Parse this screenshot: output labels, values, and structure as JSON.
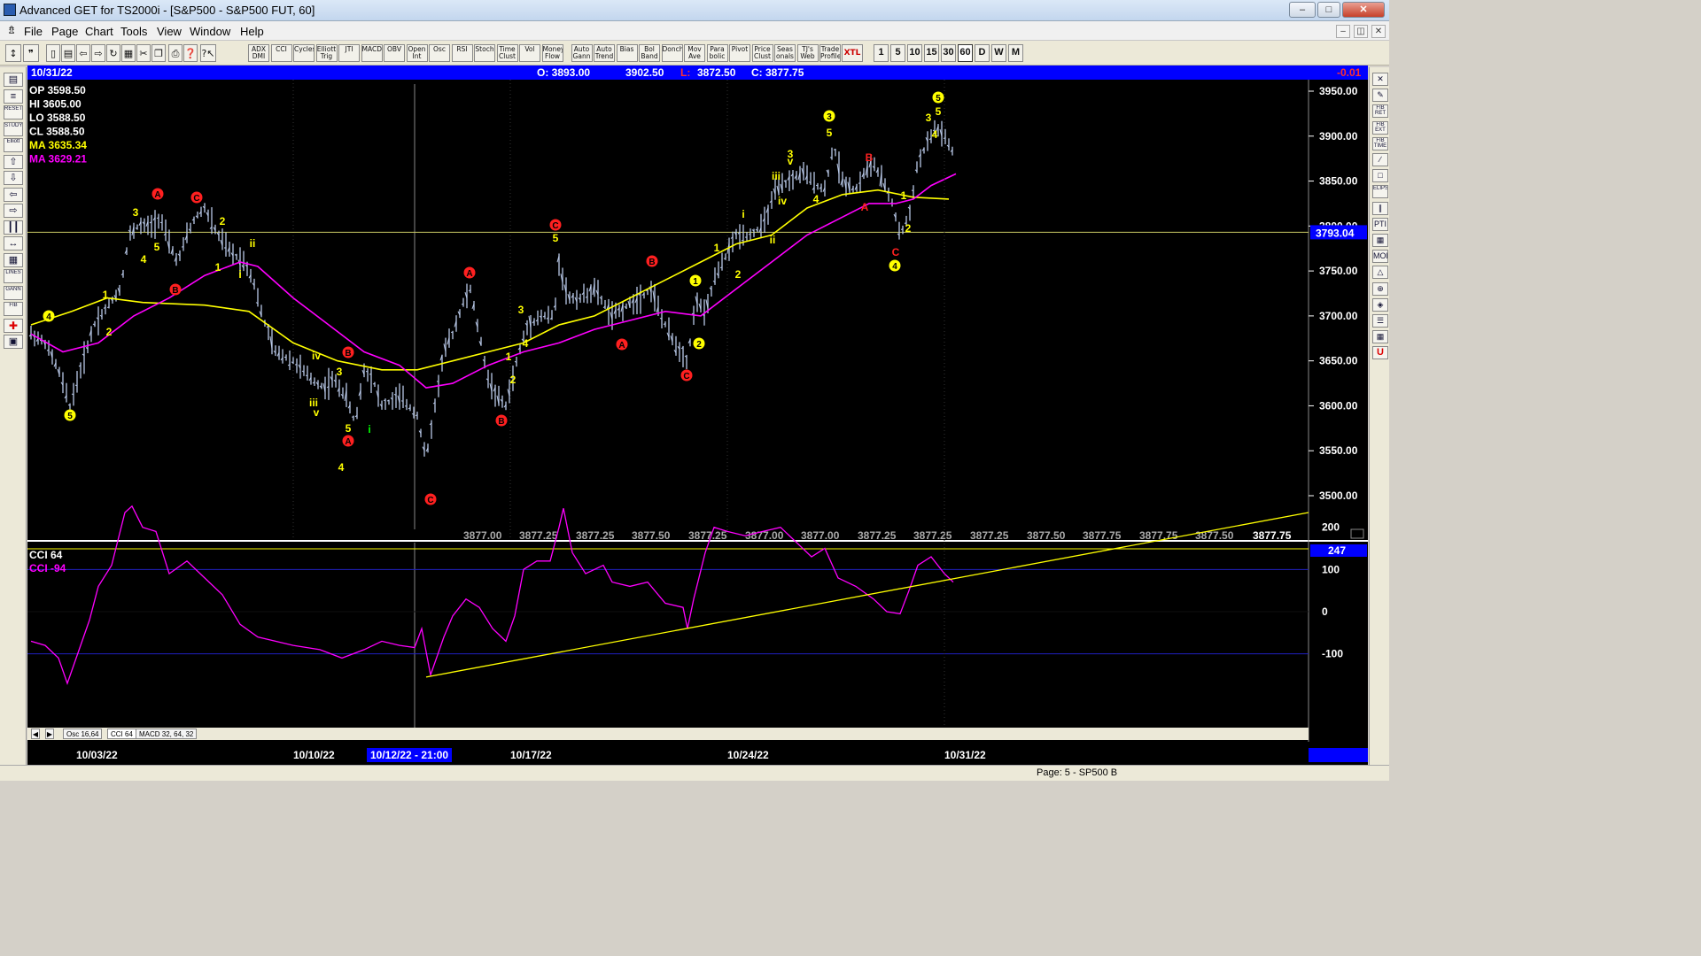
{
  "window": {
    "title": "Advanced GET for TS2000i - [S&P500 - S&P500 FUT, 60]",
    "min": "–",
    "max": "□",
    "close": "✕"
  },
  "menu": [
    "File",
    "Page",
    "Chart",
    "Tools",
    "View",
    "Window",
    "Help"
  ],
  "toolbar_studies": [
    "ADX DMI",
    "CCI",
    "Cycles",
    "Elliott Trig",
    "JTI",
    "MACD",
    "OBV",
    "Open Int",
    "Osc",
    "RSI",
    "Stoch",
    "Time Clust",
    "Vol",
    "Money Flow",
    "Auto Gann",
    "Auto Trend",
    "Bias",
    "Bol Band",
    "Donch",
    "Mov Ave",
    "Para bolic",
    "Pivot",
    "Price Clust",
    "Seas onals",
    "TJ's Web",
    "Trade Profile"
  ],
  "toolbar_xtl": "XTL",
  "intervals": [
    "1",
    "5",
    "10",
    "15",
    "30",
    "60",
    "D",
    "W",
    "M"
  ],
  "infobar": {
    "date": "10/31/22",
    "open": "O: 3893.00",
    "high": "3902.50",
    "low_label": "L:",
    "low": "3872.50",
    "close": "C:  3877.75",
    "change": "-0.01"
  },
  "readout": {
    "op": "OP  3598.50",
    "hi": "HI   3605.00",
    "lo": "LO   3588.50",
    "cl": "CL   3588.50",
    "ma1": "MA  3635.34",
    "ma2": "MA  3629.21"
  },
  "price_axis": [
    "3950.00",
    "3900.00",
    "3850.00",
    "3800.00",
    "3750.00",
    "3700.00",
    "3650.00",
    "3600.00",
    "3550.00",
    "3500.00"
  ],
  "current_price_tag": "3793.04",
  "bottom_prices": [
    "3877.00",
    "3877.25",
    "3877.25",
    "3877.50",
    "3877.25",
    "3877.00",
    "3877.00",
    "3877.25",
    "3877.25",
    "3877.25",
    "3877.50",
    "3877.75",
    "3877.75",
    "3877.50",
    "3877.75"
  ],
  "cci_panel": {
    "label1": "CCI 64",
    "label2": "CCI  -94",
    "axis": [
      "200",
      "100",
      "0",
      "-100"
    ],
    "tag": "247"
  },
  "tabs": [
    "Osc 16,64",
    "CCI 64",
    "MACD 32, 64, 32"
  ],
  "dates": [
    "10/03/22",
    "10/10/22",
    "10/17/22",
    "10/24/22",
    "10/31/22"
  ],
  "cursor_date": "10/12/22 - 21:00",
  "status": "Page: 5 - SP500 B",
  "wave_labels": [
    {
      "t": "5",
      "c": "#ffff00",
      "circle": true
    },
    {
      "t": "4",
      "c": "#ffff00",
      "circle": true
    },
    {
      "t": "1",
      "c": "#ffff00"
    },
    {
      "t": "2",
      "c": "#ffff00"
    },
    {
      "t": "3",
      "c": "#ffff00"
    },
    {
      "t": "4",
      "c": "#ffff00"
    },
    {
      "t": "5",
      "c": "#ffff00"
    },
    {
      "t": "A",
      "c": "#ff2020",
      "circle": true
    },
    {
      "t": "B",
      "c": "#ff2020",
      "circle": true
    },
    {
      "t": "C",
      "c": "#ff2020",
      "circle": true
    },
    {
      "t": "2",
      "c": "#ffff00"
    },
    {
      "t": "1",
      "c": "#ffff00"
    },
    {
      "t": "i",
      "c": "#ffff00"
    },
    {
      "t": "ii",
      "c": "#ffff00"
    },
    {
      "t": "iii",
      "c": "#ffff00"
    },
    {
      "t": "iv",
      "c": "#ffff00"
    },
    {
      "t": "v",
      "c": "#ffff00"
    },
    {
      "t": "3",
      "c": "#ffff00"
    },
    {
      "t": "4",
      "c": "#ffff00"
    },
    {
      "t": "5",
      "c": "#ffff00"
    },
    {
      "t": "A",
      "c": "#ff2020",
      "circle": true
    },
    {
      "t": "B",
      "c": "#ff2020",
      "circle": true
    },
    {
      "t": "i",
      "c": "#00ff00"
    },
    {
      "t": "C",
      "c": "#ff2020",
      "circle": true
    },
    {
      "t": "A",
      "c": "#ff2020",
      "circle": true
    },
    {
      "t": "B",
      "c": "#ff2020",
      "circle": true
    },
    {
      "t": "1",
      "c": "#ffff00"
    },
    {
      "t": "2",
      "c": "#ffff00"
    },
    {
      "t": "3",
      "c": "#ffff00"
    },
    {
      "t": "4",
      "c": "#ffff00"
    },
    {
      "t": "C",
      "c": "#ff2020",
      "circle": true
    },
    {
      "t": "5",
      "c": "#ffff00"
    },
    {
      "t": "A",
      "c": "#ff2020",
      "circle": true
    },
    {
      "t": "B",
      "c": "#ff2020",
      "circle": true
    },
    {
      "t": "C",
      "c": "#ff2020",
      "circle": true
    },
    {
      "t": "1",
      "c": "#ffff00",
      "circle": true
    },
    {
      "t": "2",
      "c": "#ffff00",
      "circle": true
    },
    {
      "t": "1",
      "c": "#ffff00"
    },
    {
      "t": "2",
      "c": "#ffff00"
    },
    {
      "t": "i",
      "c": "#ffff00"
    },
    {
      "t": "ii",
      "c": "#ffff00"
    },
    {
      "t": "iii",
      "c": "#ffff00"
    },
    {
      "t": "iv",
      "c": "#ffff00"
    },
    {
      "t": "3",
      "c": "#ffff00"
    },
    {
      "t": "v",
      "c": "#ffff00"
    },
    {
      "t": "4",
      "c": "#ffff00"
    },
    {
      "t": "3",
      "c": "#ffff00",
      "circle": true
    },
    {
      "t": "5",
      "c": "#ffff00"
    },
    {
      "t": "B",
      "c": "#ff2020"
    },
    {
      "t": "A",
      "c": "#ff2020"
    },
    {
      "t": "C",
      "c": "#ff2020"
    },
    {
      "t": "4",
      "c": "#ffff00",
      "circle": true
    },
    {
      "t": "1",
      "c": "#ffff00"
    },
    {
      "t": "2",
      "c": "#ffff00"
    },
    {
      "t": "3",
      "c": "#ffff00"
    },
    {
      "t": "4",
      "c": "#ffff00"
    },
    {
      "t": "5",
      "c": "#ffff00"
    },
    {
      "t": "5",
      "c": "#ffff00",
      "circle": true
    }
  ],
  "colors": {
    "bars": "#b8c8e8",
    "ma_fast": "#ffff00",
    "ma_slow": "#ff00ff",
    "cci": "#ff00ff",
    "trendline": "#ffff00",
    "infobar": "#0000ff"
  }
}
